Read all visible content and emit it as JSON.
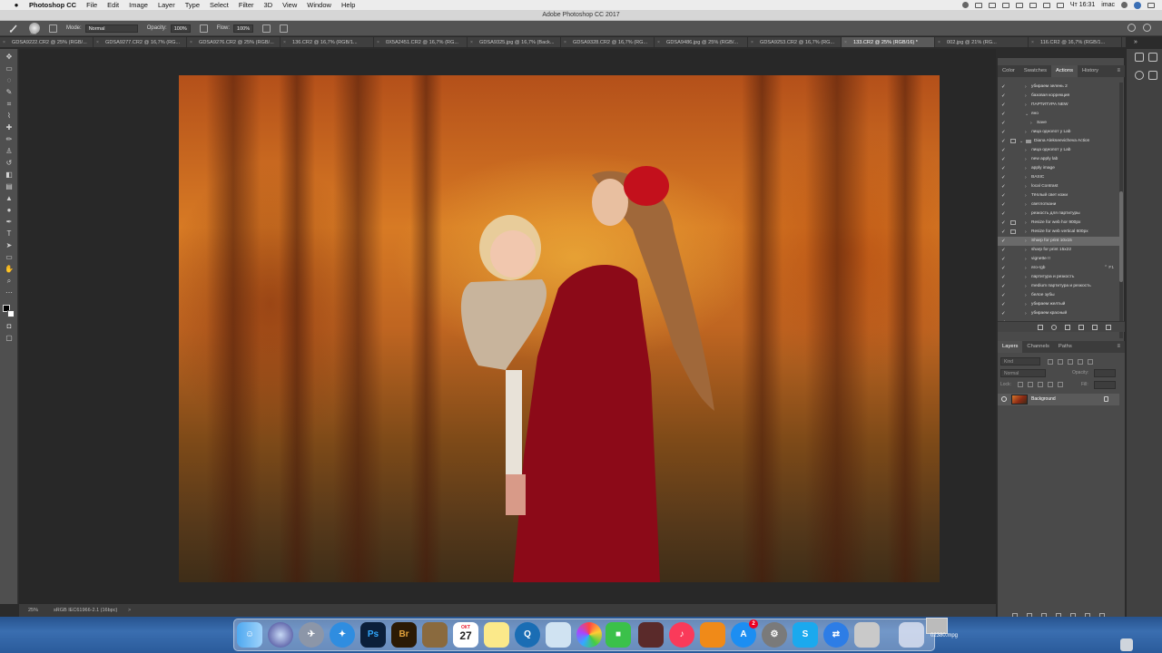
{
  "macos_menubar": {
    "app_name": "Photoshop CC",
    "menus": [
      "File",
      "Edit",
      "Image",
      "Layer",
      "Type",
      "Select",
      "Filter",
      "3D",
      "View",
      "Window",
      "Help"
    ],
    "clock": "Чт 16:31",
    "user": "imac"
  },
  "window_title": "Adobe Photoshop CC 2017",
  "options_bar": {
    "brush_size": "700",
    "mode_label": "Mode:",
    "mode_value": "Normal",
    "opacity_label": "Opacity:",
    "opacity_value": "100%",
    "flow_label": "Flow:",
    "flow_value": "100%"
  },
  "document_tabs": [
    {
      "title": "GDSA9222.CR2 @ 25% (RGB/..."
    },
    {
      "title": "GDSA9277.CR2 @ 16,7% (RG..."
    },
    {
      "title": "GDSA9276.CR2 @ 25% (RGB/..."
    },
    {
      "title": "136.CR2 @ 16,7% (RGB/1..."
    },
    {
      "title": "0X5A2451.CR2 @ 16,7% (RG..."
    },
    {
      "title": "GDSA9325.jpg @ 16,7% (Back..."
    },
    {
      "title": "GDSA9328.CR2 @ 16,7% (RG..."
    },
    {
      "title": "GDSA9486.jpg @ 25% (RGB/..."
    },
    {
      "title": "GDSA9253.CR2 @ 16,7% (RG..."
    },
    {
      "title": "133.CR2 @ 25% (RGB/16) *",
      "active": true
    },
    {
      "title": "002.jpg @ 21% (RG..."
    },
    {
      "title": "116.CR2 @ 16,7% (RGB/1..."
    }
  ],
  "status_bar": {
    "zoom": "25%",
    "info": "sRGB IEC61966-2.1 (16bpc)",
    "arrow": ">"
  },
  "actions_panel": {
    "tabs": [
      "Color",
      "Swatches",
      "Actions",
      "History"
    ],
    "active_tab": "Actions",
    "rows": [
      {
        "label": "убираем зелень 2",
        "indent": 2
      },
      {
        "label": "базовая коррекция",
        "indent": 2
      },
      {
        "label": "ПАРТИТУРА NEW",
        "indent": 2
      },
      {
        "label": "яно",
        "indent": 2,
        "expanded": true
      },
      {
        "label": "Save",
        "indent": 3
      },
      {
        "label": "лица однолот у Lab",
        "indent": 2
      },
      {
        "label": "Diana Alekseevicheva Action",
        "indent": 1,
        "set": true,
        "dialog": true
      },
      {
        "label": "лица однолот у Lab",
        "indent": 2
      },
      {
        "label": "new apply lab",
        "indent": 2
      },
      {
        "label": "apply image",
        "indent": 2
      },
      {
        "label": "BASIC",
        "indent": 2
      },
      {
        "label": "local Contrast",
        "indent": 2
      },
      {
        "label": "Тёплый свет кожи",
        "indent": 2
      },
      {
        "label": "светлоткани",
        "indent": 2
      },
      {
        "label": "резкость для партитуры",
        "indent": 2
      },
      {
        "label": "Resize for web hor 900px",
        "indent": 2,
        "dialog": true
      },
      {
        "label": "Resize for web vertical 600px",
        "indent": 2,
        "dialog": true
      },
      {
        "label": "Sharp for print 10x15",
        "indent": 2,
        "selected": true
      },
      {
        "label": "sharp for print 15x22",
        "indent": 2
      },
      {
        "label": "vignette !!",
        "indent": 2
      },
      {
        "label": "яго-rgb",
        "indent": 2,
        "key": "⌃ F1"
      },
      {
        "label": "партитура и резкость",
        "indent": 2
      },
      {
        "label": "medium партитура и резкость",
        "indent": 2
      },
      {
        "label": "белое зубы",
        "indent": 2
      },
      {
        "label": "убираем желтый",
        "indent": 2
      },
      {
        "label": "убираем красный",
        "indent": 2
      },
      {
        "label": "......",
        "indent": 2
      }
    ]
  },
  "layers_panel": {
    "tabs": [
      "Layers",
      "Channels",
      "Paths"
    ],
    "active_tab": "Layers",
    "kind_placeholder": "Kind",
    "blend_mode": "Normal",
    "opacity_label": "Opacity:",
    "lock_label": "Lock:",
    "fill_label": "Fill:",
    "layers": [
      {
        "name": "Background",
        "visible": true,
        "locked": true
      }
    ]
  },
  "dock": {
    "calendar_day": "27",
    "calendar_month": "ОКТ",
    "appstore_badge": "2",
    "file_label": "02380.mpg"
  }
}
